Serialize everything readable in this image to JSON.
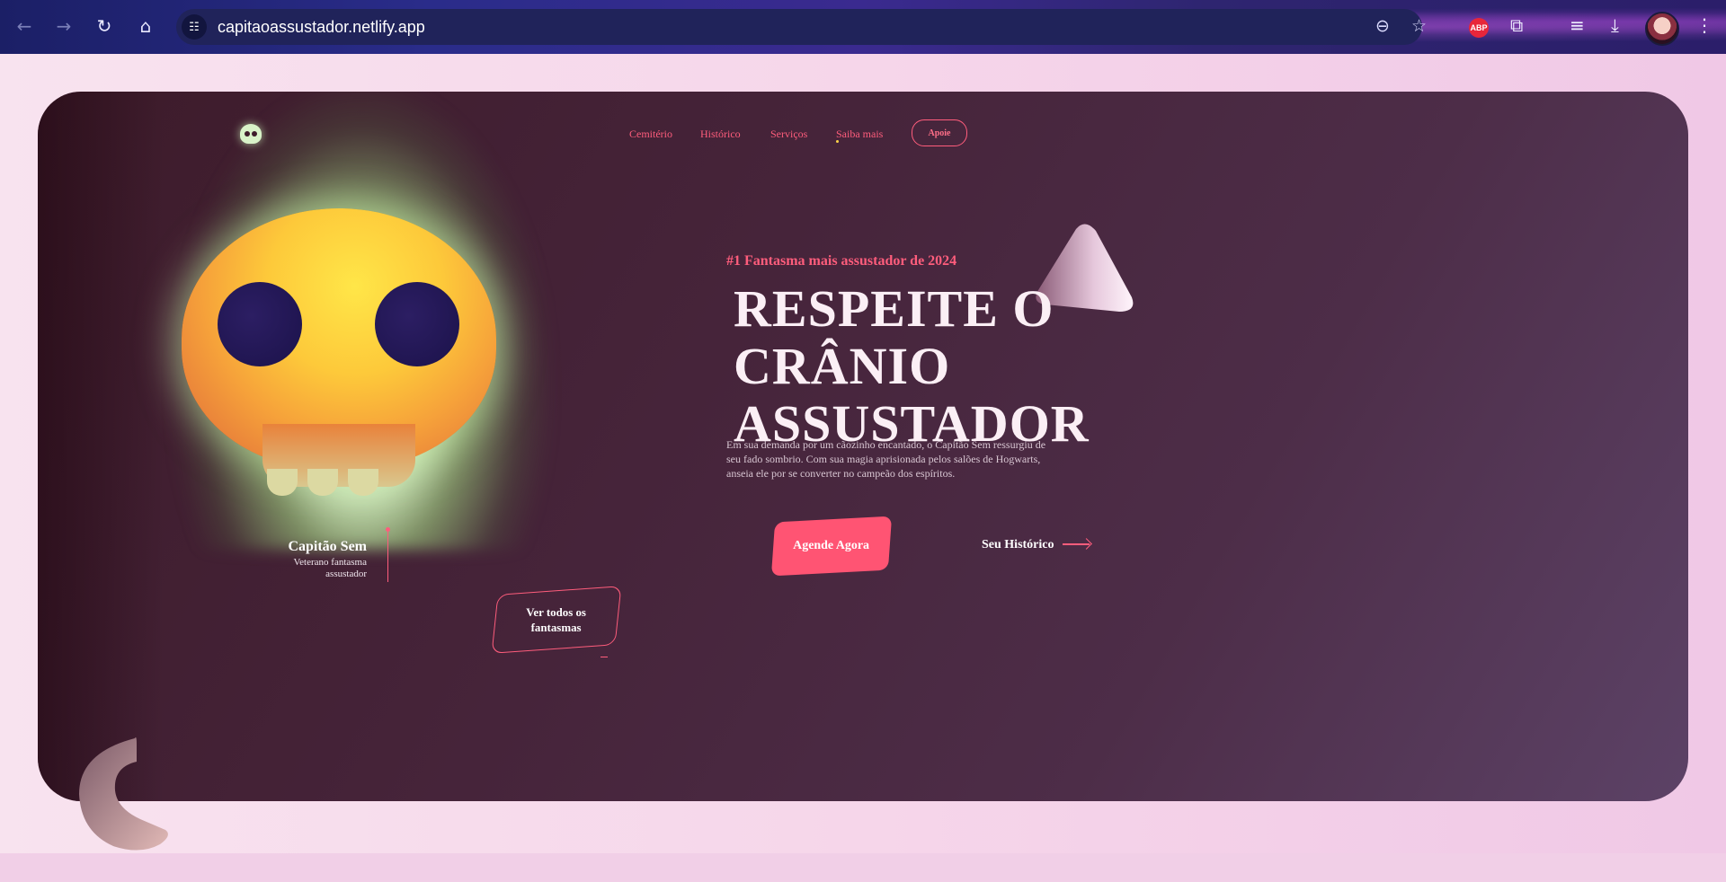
{
  "browser": {
    "url": "capitaoassustador.netlify.app",
    "adblock_label": "ABP",
    "icons": {
      "back": "←",
      "forward": "→",
      "reload": "↻",
      "home": "⌂",
      "site_info": "☷",
      "zoom": "⊖",
      "bookmark": "☆",
      "extensions": "⧉",
      "media": "≡",
      "downloads": "⤓",
      "menu": "⋮"
    }
  },
  "site": {
    "nav": {
      "items": [
        "Cemitério",
        "Histórico",
        "Serviços",
        "Saiba mais"
      ],
      "cta": "Apoie"
    },
    "hero": {
      "tagline": "#1 Fantasma mais assustador de 2024",
      "title_line1": "RESPEITE O",
      "title_line2": "CRÂNIO",
      "title_line3": "ASSUSTADOR",
      "description": "Em sua demanda por um cãozinho encantado, o Capitão Sem ressurgiu de seu fado sombrio. Com sua magia aprisionada pelos salões de Hogwarts, anseia ele por se converter no campeão dos espíritos.",
      "primary_button": "Agende Agora",
      "secondary_link": "Seu Histórico"
    },
    "profile": {
      "name": "Capitão Sem",
      "subtitle_line1": "Veterano fantasma",
      "subtitle_line2": "assustador"
    },
    "ghosts_button": {
      "line1": "Ver todos os",
      "line2": "fantasmas"
    },
    "colors": {
      "accent": "#ff5d7c",
      "card_bg": "#46243a",
      "page_bg": "#f5d9ec"
    }
  }
}
